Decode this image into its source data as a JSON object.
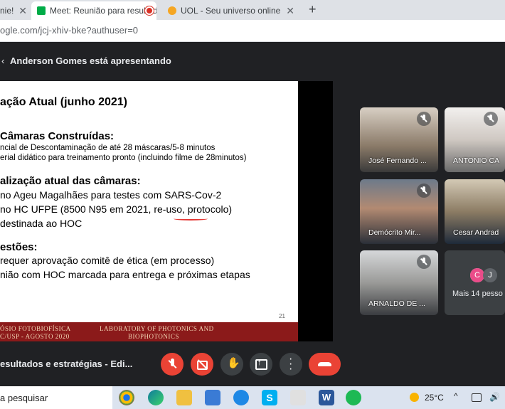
{
  "browser": {
    "tabs": [
      {
        "label": "nie!"
      },
      {
        "label": "Meet: Reunião para resultad"
      },
      {
        "label": "UOL - Seu universo online"
      }
    ],
    "new_tab": "+",
    "url": "ogle.com/jcj-xhiv-bke?authuser=0"
  },
  "meet": {
    "presenting": "Anderson Gomes está apresentando",
    "meeting_title": "esultados e estratégias - Edi...",
    "participants": [
      {
        "name": "José Fernando ..."
      },
      {
        "name": "ANTONIO CA"
      },
      {
        "name": "Demócrito Mir..."
      },
      {
        "name": "Cesar Andrad"
      },
      {
        "name": "ARNALDO DE ..."
      }
    ],
    "more": {
      "label": "Mais 14 pesso",
      "avatars": [
        "C",
        "J"
      ]
    }
  },
  "slide": {
    "title": "ação Atual (junho 2021)",
    "s1_title": "Câmaras Construídas:",
    "s1_lines": [
      "ncial de Descontaminação de até 28 máscaras/5-8 minutos",
      "erial didático para treinamento pronto (incluindo filme de 28minutos)"
    ],
    "s2_title": "alização atual das câmaras:",
    "s2_lines": [
      "no Ageu Magalhães para testes com SARS-Cov-2",
      "no HC UFPE (8500 N95 em 2021, re-uso, protocolo)",
      "destinada ao HOC"
    ],
    "s3_title": "estões:",
    "s3_lines": [
      "requer aprovação comitê de ética (em processo)",
      "nião com HOC marcada para entrega e próximas etapas"
    ],
    "page_number": "21",
    "footer_left1": "ÓSIO FOTOBIOFÍSICA",
    "footer_left2": "C/USP - AGOSTO 2020",
    "footer_right1": "LABORATORY OF PHOTONICS AND",
    "footer_right2": "BIOPHOTONICS"
  },
  "taskbar": {
    "search": "a pesquisar",
    "temperature": "25°C"
  },
  "colors": {
    "end_call": "#ea4335",
    "meet_bg": "#202124"
  }
}
